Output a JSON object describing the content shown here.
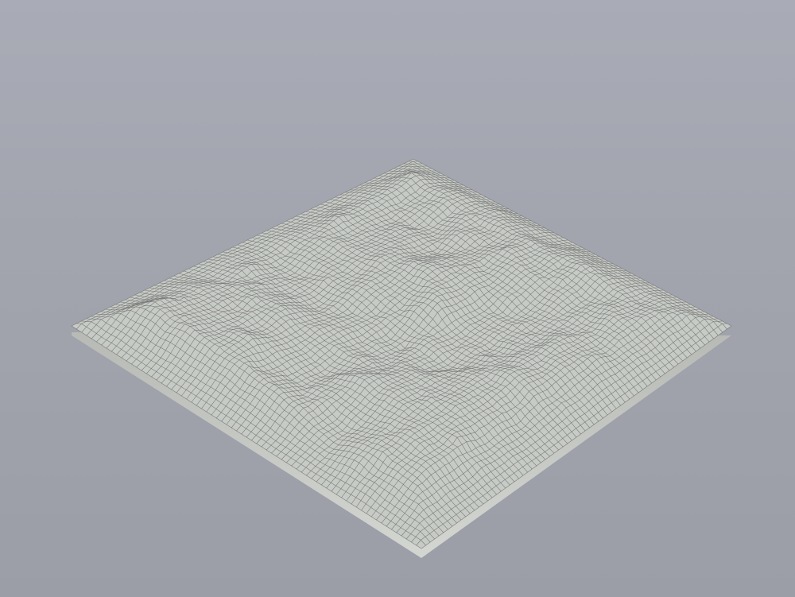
{
  "viewport": {
    "background_top": "#a9abb6",
    "background_bottom": "#9b9da7"
  },
  "mesh": {
    "object": "terrain-wireframe-mesh",
    "render_mode": "wireframe",
    "fill_color": "#c7cbc6",
    "wire_color": "#6e706d",
    "shadow_color": "#8f928e",
    "grid_resolution": 70
  }
}
